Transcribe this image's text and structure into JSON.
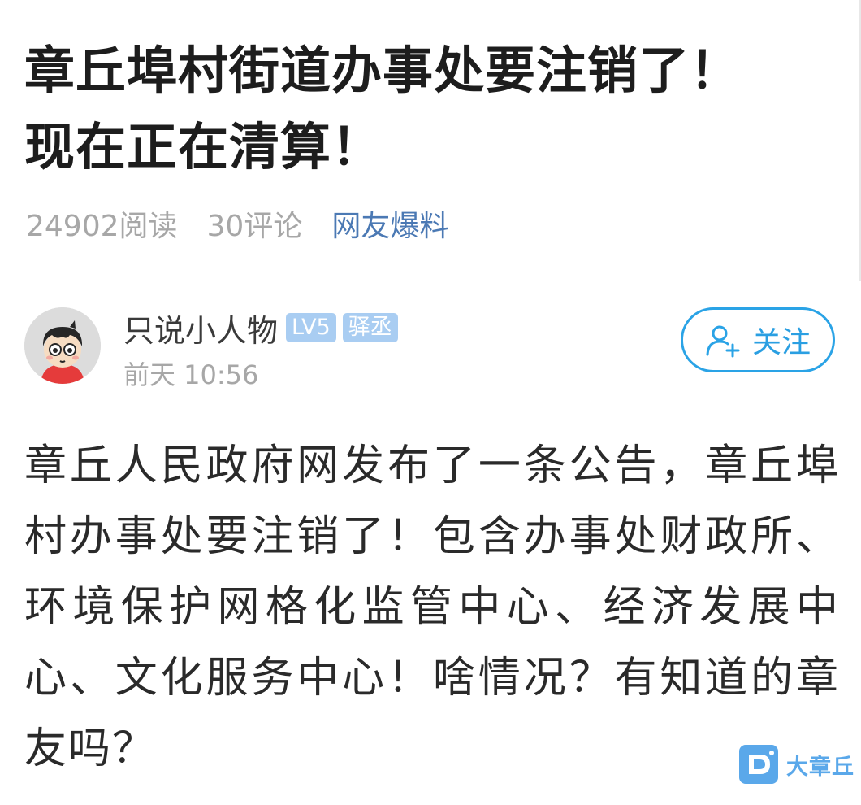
{
  "article": {
    "title": "章丘埠村街道办事处要注销了！现在正在清算！",
    "reads": "24902阅读",
    "comments": "30评论",
    "category": "网友爆料"
  },
  "author": {
    "name": "只说小人物",
    "level_badge": "LV5",
    "title_badge": "驿丞",
    "time": "前天 10:56",
    "follow_label": "关注"
  },
  "content": {
    "body": "章丘人民政府网发布了一条公告，章丘埠村办事处要注销了！包含办事处财政所、环境保护网格化监管中心、经济发展中心、文化服务中心！啥情况？有知道的章友吗？"
  },
  "watermark": {
    "text": "大章丘"
  },
  "colors": {
    "accent": "#2aa3e6",
    "category_link": "#4b79b4",
    "badge": "#a9cdf2",
    "muted_text": "#a7a7a7",
    "watermark": "#5aa8ea"
  },
  "icons": {
    "follow": "add-user-icon",
    "watermark_logo": "da-zhangqiu-logo-icon"
  }
}
